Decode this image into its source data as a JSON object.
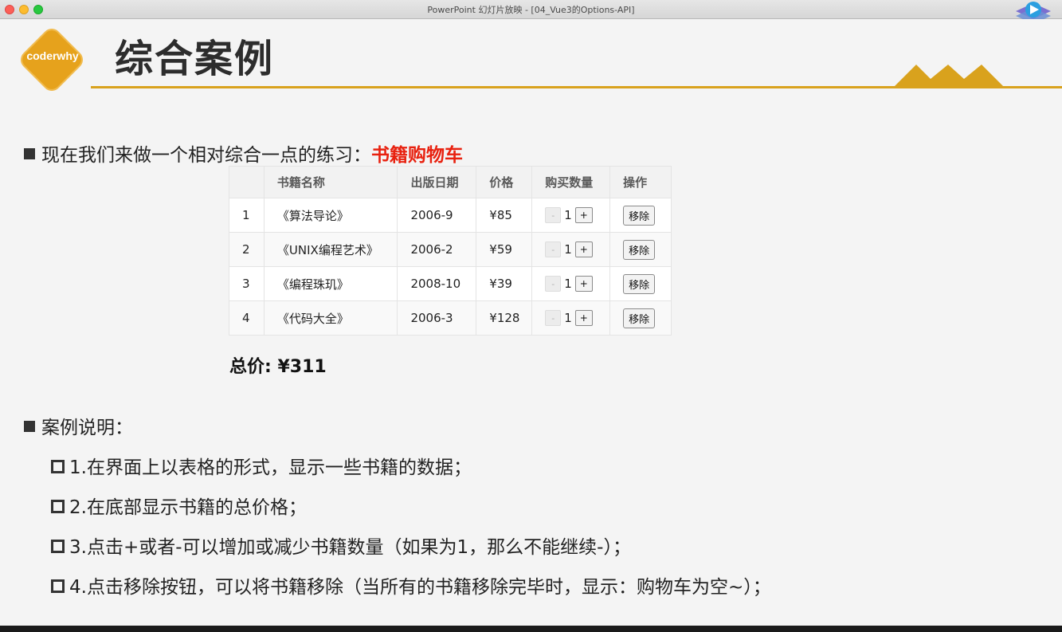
{
  "window": {
    "title": "PowerPoint 幻灯片放映 - [04_Vue3的Options-API]"
  },
  "slide": {
    "logo_text": "coderwhy",
    "title": "综合案例",
    "intro": {
      "text": "现在我们来做一个相对综合一点的练习：",
      "highlight": "书籍购物车"
    },
    "table": {
      "headers": [
        "",
        "书籍名称",
        "出版日期",
        "价格",
        "购买数量",
        "操作"
      ],
      "rows": [
        {
          "index": "1",
          "name": "《算法导论》",
          "date": "2006-9",
          "price": "¥85",
          "qty": "1"
        },
        {
          "index": "2",
          "name": "《UNIX编程艺术》",
          "date": "2006-2",
          "price": "¥59",
          "qty": "1"
        },
        {
          "index": "3",
          "name": "《编程珠玑》",
          "date": "2008-10",
          "price": "¥39",
          "qty": "1"
        },
        {
          "index": "4",
          "name": "《代码大全》",
          "date": "2006-3",
          "price": "¥128",
          "qty": "1"
        }
      ],
      "minus_label": "-",
      "plus_label": "+",
      "remove_label": "移除"
    },
    "total": "总价: ¥311",
    "explain_heading": "案例说明：",
    "explain_items": [
      "1.在界面上以表格的形式，显示一些书籍的数据；",
      "2.在底部显示书籍的总价格；",
      "3.点击+或者-可以增加或减少书籍数量（如果为1，那么不能继续-）；",
      "4.点击移除按钮，可以将书籍移除（当所有的书籍移除完毕时，显示：购物车为空~）；"
    ]
  },
  "colors": {
    "accent": "#d9a21d",
    "highlight": "#e8210f"
  }
}
